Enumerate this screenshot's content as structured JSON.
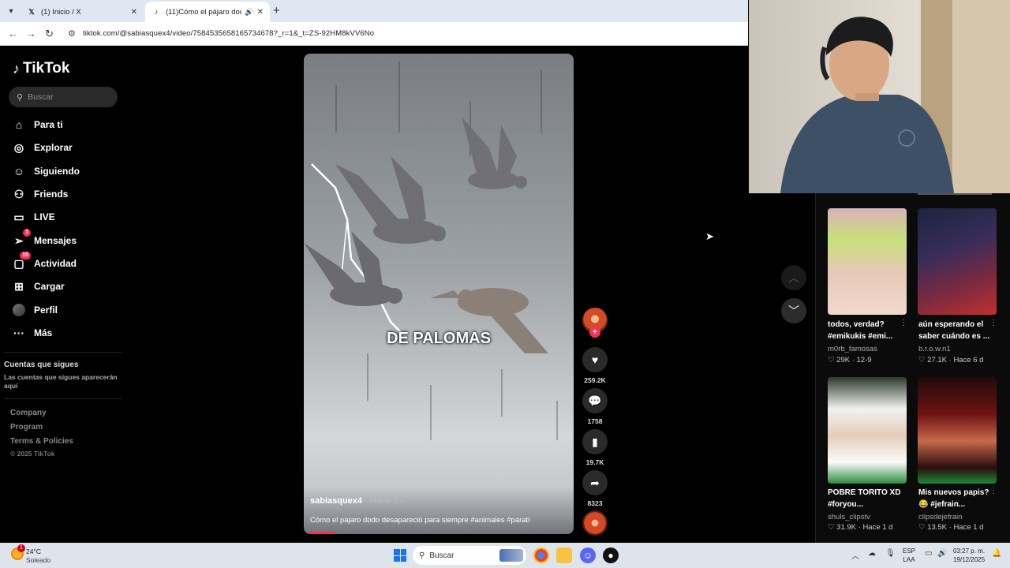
{
  "browser": {
    "tabs": [
      {
        "title": "(1) Inicio / X",
        "favicon": "x-logo"
      },
      {
        "title": "(11)Cómo el pájaro dodo d",
        "favicon": "tiktok-logo",
        "active": true
      }
    ],
    "url": "tiktok.com/@sabiasquex4/video/7584535658165734678?_r=1&_t=ZS-92HM8kVV6No"
  },
  "sidebar": {
    "logo": "TikTok",
    "search_placeholder": "Buscar",
    "nav": [
      {
        "label": "Para ti",
        "icon": "home-icon"
      },
      {
        "label": "Explorar",
        "icon": "compass-icon"
      },
      {
        "label": "Siguiendo",
        "icon": "user-follow-icon"
      },
      {
        "label": "Friends",
        "icon": "friends-icon"
      },
      {
        "label": "LIVE",
        "icon": "live-icon"
      },
      {
        "label": "Mensajes",
        "icon": "send-icon",
        "badge": "1"
      },
      {
        "label": "Actividad",
        "icon": "activity-icon",
        "badge": "10"
      },
      {
        "label": "Cargar",
        "icon": "upload-icon"
      },
      {
        "label": "Perfil",
        "icon": "avatar"
      },
      {
        "label": "Más",
        "icon": "more-icon"
      }
    ],
    "following_title": "Cuentas que sigues",
    "following_sub": "Las cuentas que sigues aparecerán aquí",
    "footer": [
      "Company",
      "Program",
      "Terms & Policies"
    ],
    "copyright": "© 2025 TikTok"
  },
  "video": {
    "overlay_text": "DE PALOMAS",
    "author": "sabiasquex4",
    "time": " · Hace 3 d",
    "caption": "Cómo el pájaro dodo desapareció para siempre #animales #parati",
    "progress": 0.1
  },
  "actions": {
    "likes": "259.2K",
    "comments": "1758",
    "saves": "19.7K",
    "shares": "8323"
  },
  "related": [
    {
      "title": "todos, verdad? #emikukis #emi...",
      "user": "m0rb_famosas",
      "likes": "29K",
      "date": "12-9"
    },
    {
      "title": "aún esperando el saber cuándo es ...",
      "user": "b.r.o.w.n1",
      "likes": "27.1K",
      "date": "Hace 6 d"
    },
    {
      "title": "POBRE TORITO XD #foryou...",
      "user": "shuls_clipstv",
      "likes": "31.9K",
      "date": "Hace 1 d"
    },
    {
      "title": "Mis nuevos papis? 😂 #jefrain...",
      "user": "clipsdejefrain",
      "likes": "13.5K",
      "date": "Hace 1 d"
    }
  ],
  "taskbar": {
    "temp": "24°C",
    "weather": "Soleado",
    "weather_badge": "1",
    "search": "Buscar",
    "lang_1": "ESP",
    "lang_2": "LAA",
    "time": "03:27 p. m.",
    "date": "19/12/2025"
  },
  "colors": {
    "accent": "#fe2c55",
    "background": "#000000"
  }
}
